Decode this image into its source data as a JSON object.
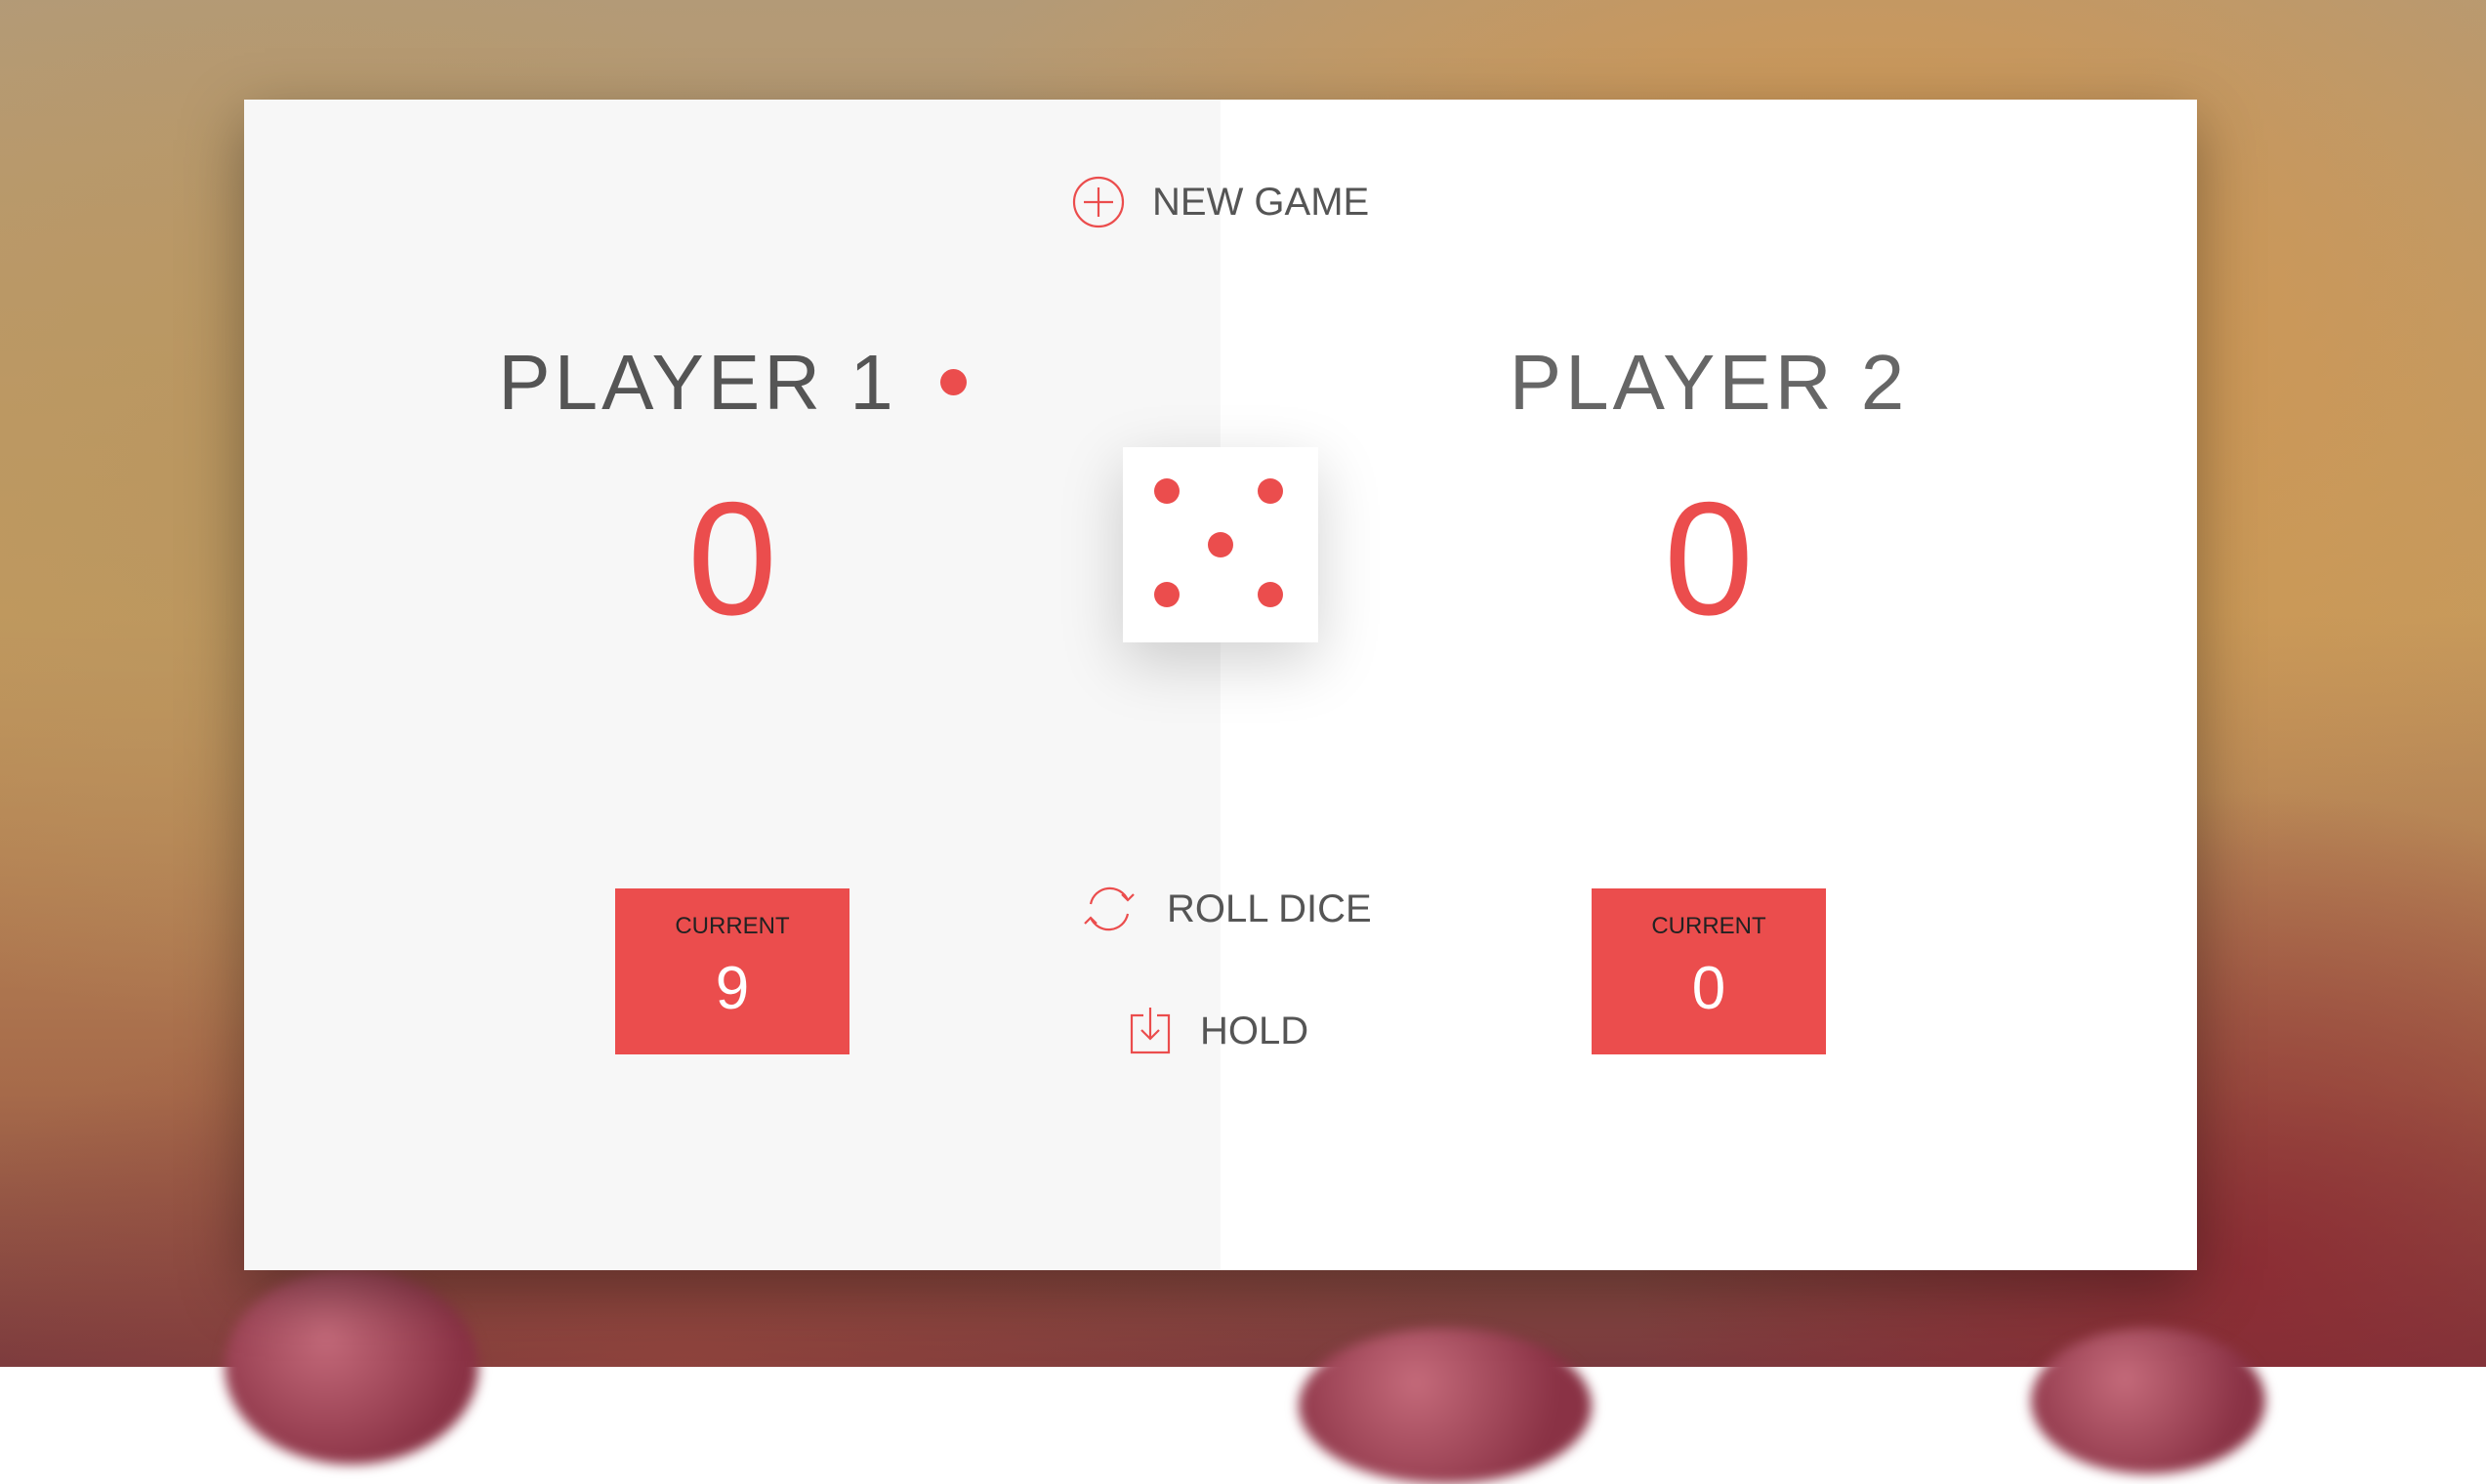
{
  "buttons": {
    "new_game": "NEW GAME",
    "roll_dice": "ROLL DICE",
    "hold": "HOLD"
  },
  "players": [
    {
      "name": "PLAYER 1",
      "score": "0",
      "current_label": "CURRENT",
      "current_score": "9",
      "active": true
    },
    {
      "name": "PLAYER 2",
      "score": "0",
      "current_label": "CURRENT",
      "current_score": "0",
      "active": false
    }
  ],
  "dice": {
    "value": 5
  },
  "icons": {
    "new_game": "plus-circle-icon",
    "roll_dice": "refresh-icon",
    "hold": "download-icon",
    "active_player": "dot-icon"
  },
  "colors": {
    "accent": "#eb4d4d",
    "active_panel": "#f7f7f7",
    "inactive_panel": "#ffffff",
    "text": "#555555"
  }
}
